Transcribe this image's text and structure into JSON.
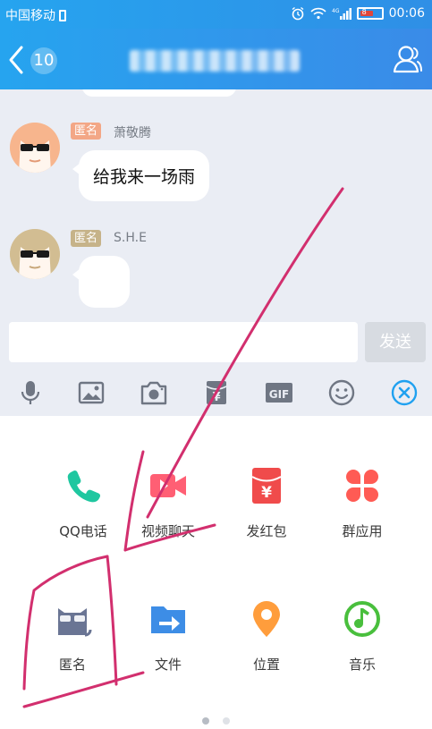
{
  "status_bar": {
    "carrier": "中国移动",
    "battery": "8",
    "time": "00:06"
  },
  "nav": {
    "unread_count": "10"
  },
  "messages": [
    {
      "tag": "匿名",
      "tag_color": "#f3a786",
      "sender": "萧敬腾",
      "text": "给我来一场雨"
    },
    {
      "tag": "匿名",
      "tag_color": "#c6b389",
      "sender": "S.H.E",
      "text": ""
    }
  ],
  "input": {
    "value": "",
    "send_label": "发送"
  },
  "toolbar": {
    "gif_label": "GIF",
    "yen": "¥"
  },
  "panel": {
    "items": [
      {
        "label": "QQ电话",
        "icon": "phone-icon",
        "color": "#1fc7a0"
      },
      {
        "label": "视频聊天",
        "icon": "video-camera-icon",
        "color": "#ff5f74"
      },
      {
        "label": "发红包",
        "icon": "red-packet-icon",
        "color": "#f04b4b"
      },
      {
        "label": "群应用",
        "icon": "grid-petal-icon",
        "color": "#ff5b54"
      },
      {
        "label": "匿名",
        "icon": "anonymous-mask-icon",
        "color": "#6a7594"
      },
      {
        "label": "文件",
        "icon": "file-icon",
        "color": "#3d8de6"
      },
      {
        "label": "位置",
        "icon": "location-pin-icon",
        "color": "#ff9d3c"
      },
      {
        "label": "音乐",
        "icon": "music-note-icon",
        "color": "#49bf3d"
      }
    ],
    "page_dots": [
      {
        "active": true
      },
      {
        "active": false
      }
    ]
  },
  "colors": {
    "accent": "#2f8fe6",
    "annotation": "#d22f6e"
  }
}
